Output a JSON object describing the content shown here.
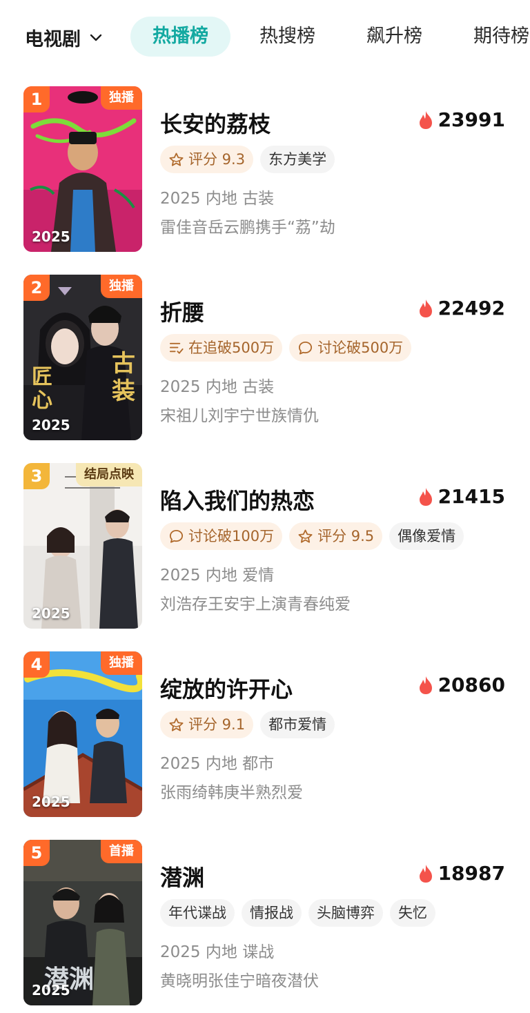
{
  "header": {
    "category": "电视剧",
    "tabs": [
      {
        "label": "热播榜",
        "active": true
      },
      {
        "label": "热搜榜",
        "active": false
      },
      {
        "label": "飙升榜",
        "active": false
      },
      {
        "label": "期待榜",
        "active": false
      }
    ]
  },
  "colors": {
    "accent": "#13a9a1",
    "rank_top": "#ff6a2a",
    "rank_third": "#f3b63a",
    "flame": "#f4534b"
  },
  "shows": [
    {
      "rank": "1",
      "badge": "独播",
      "poster_year": "2025",
      "title": "长安的荔枝",
      "heat": "23991",
      "tags": [
        {
          "icon": "star-icon",
          "text": "评分 9.3",
          "style": "highlight"
        },
        {
          "icon": "",
          "text": "东方美学",
          "style": "plain"
        }
      ],
      "meta": "2025 内地 古装",
      "desc": "雷佳音岳云鹏携手“荔”劫"
    },
    {
      "rank": "2",
      "badge": "独播",
      "poster_year": "2025",
      "title": "折腰",
      "heat": "22492",
      "tags": [
        {
          "icon": "list-icon",
          "text": "在追破500万",
          "style": "highlight"
        },
        {
          "icon": "chat-bubble-icon",
          "text": "讨论破500万",
          "style": "highlight"
        }
      ],
      "meta": "2025 内地 古装",
      "desc": "宋祖儿刘宇宁世族情仇"
    },
    {
      "rank": "3",
      "badge": "结局点映",
      "poster_year": "2025",
      "title": "陷入我们的热恋",
      "heat": "21415",
      "tags": [
        {
          "icon": "chat-bubble-icon",
          "text": "讨论破100万",
          "style": "highlight"
        },
        {
          "icon": "star-icon",
          "text": "评分 9.5",
          "style": "highlight"
        },
        {
          "icon": "",
          "text": "偶像爱情",
          "style": "plain"
        }
      ],
      "meta": "2025 内地 爱情",
      "desc": "刘浩存王安宇上演青春纯爱"
    },
    {
      "rank": "4",
      "badge": "独播",
      "poster_year": "2025",
      "title": "绽放的许开心",
      "heat": "20860",
      "tags": [
        {
          "icon": "star-icon",
          "text": "评分 9.1",
          "style": "highlight"
        },
        {
          "icon": "",
          "text": "都市爱情",
          "style": "plain"
        }
      ],
      "meta": "2025 内地 都市",
      "desc": "张雨绮韩庚半熟烈爱"
    },
    {
      "rank": "5",
      "badge": "首播",
      "poster_year": "2025",
      "title": "潜渊",
      "heat": "18987",
      "tags": [
        {
          "icon": "",
          "text": "年代谍战",
          "style": "plain"
        },
        {
          "icon": "",
          "text": "情报战",
          "style": "plain"
        },
        {
          "icon": "",
          "text": "头脑博弈",
          "style": "plain"
        },
        {
          "icon": "",
          "text": "失忆",
          "style": "plain"
        }
      ],
      "meta": "2025 内地 谍战",
      "desc": "黄晓明张佳宁暗夜潜伏"
    }
  ]
}
